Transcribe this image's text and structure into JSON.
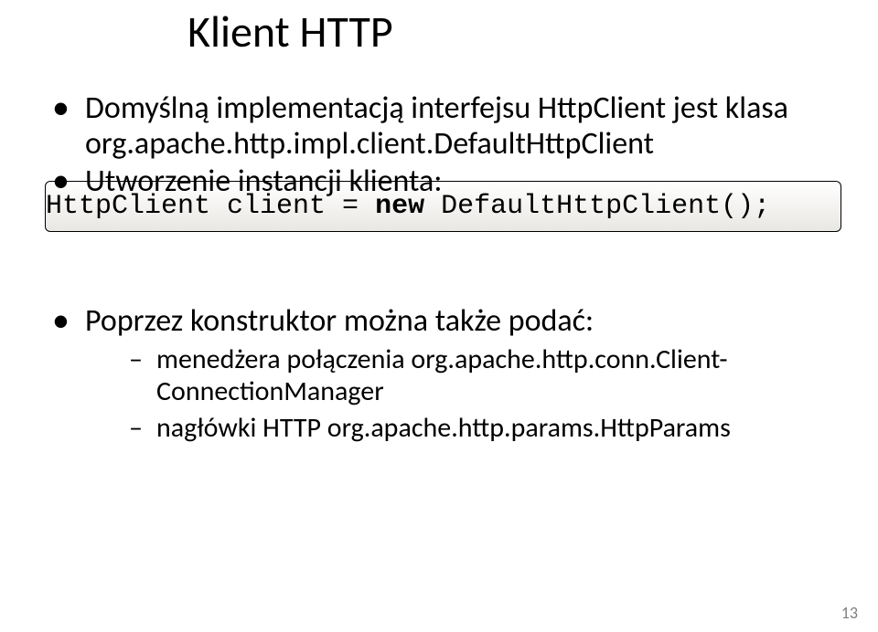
{
  "title": "Klient HTTP",
  "bullets1": [
    "Domyślną implementacją interfejsu HttpClient jest klasa org.apache.http.impl.client.DefaultHttpClient",
    "Utworzenie instancji klienta:"
  ],
  "code": {
    "prefix": "HttpClient client = ",
    "keyword": "new",
    "suffix": " DefaultHttpClient();"
  },
  "bullets2_main": "Poprzez konstruktor można także podać:",
  "bullets2_sub": [
    "menedżera połączenia org.apache.http.conn.Client-ConnectionManager",
    "nagłówki HTTP org.apache.http.params.HttpParams"
  ],
  "page_number": "13"
}
